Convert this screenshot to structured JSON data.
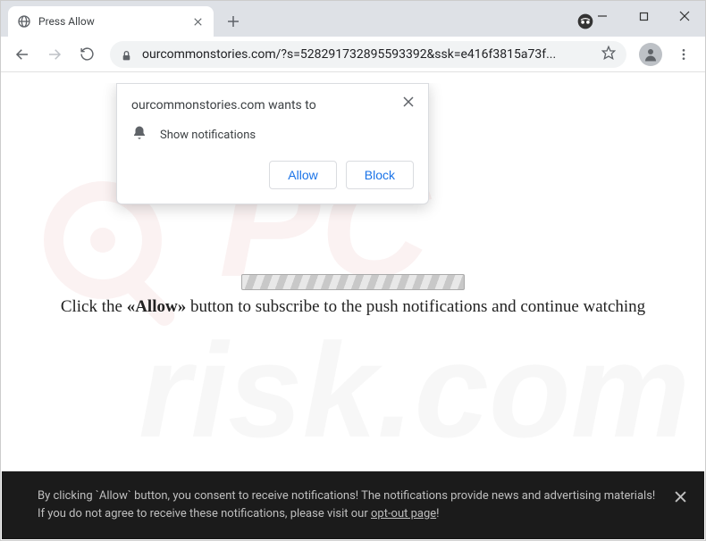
{
  "window": {
    "tab_title": "Press Allow",
    "url_display": "ourcommonstories.com/?s=528291732895593392&ssk=e416f3815a73f..."
  },
  "permission": {
    "title": "ourcommonstories.com wants to",
    "item": "Show notifications",
    "allow": "Allow",
    "block": "Block"
  },
  "page": {
    "instruction_pre": "Click the ",
    "instruction_bold": "«Allow»",
    "instruction_post": " button to subscribe to the push notifications and continue watching"
  },
  "consent": {
    "text_pre": "By clicking `Allow` button, you consent to receive notifications! The notifications provide news and advertising materials! If you do not agree to receive these notifications, please visit our ",
    "link": "opt-out page",
    "text_post": "!"
  },
  "watermark": {
    "line1": "PC",
    "line2": "risk.com"
  }
}
